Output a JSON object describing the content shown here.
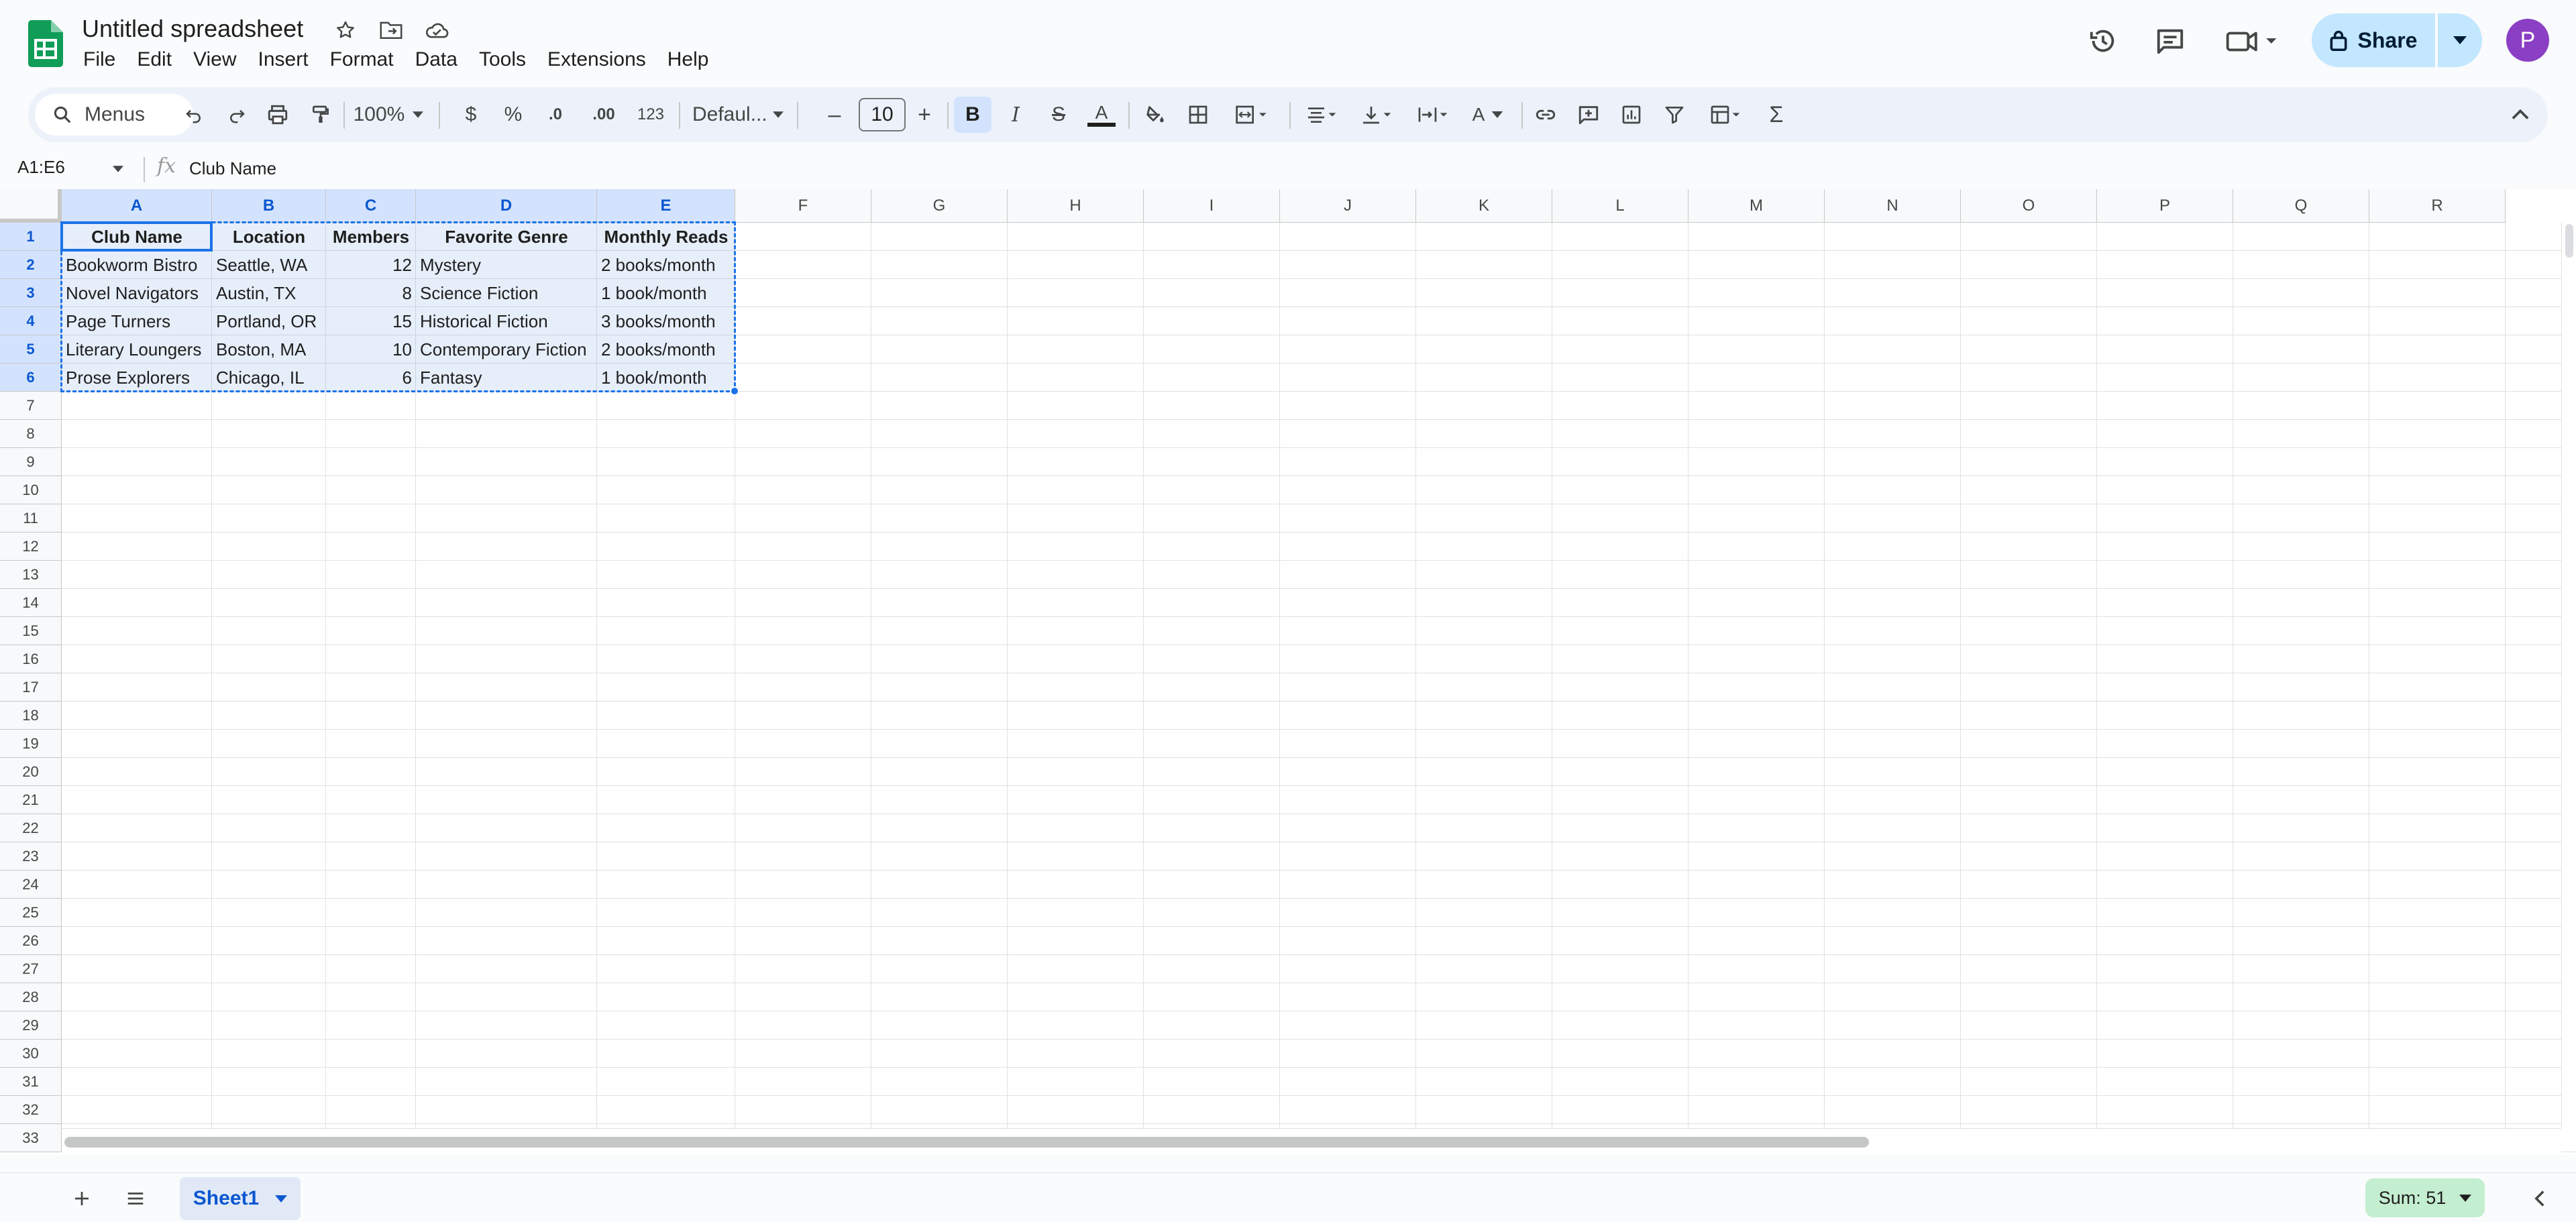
{
  "document": {
    "title": "Untitled spreadsheet",
    "menus": [
      "File",
      "Edit",
      "View",
      "Insert",
      "Format",
      "Data",
      "Tools",
      "Extensions",
      "Help"
    ]
  },
  "header_actions": {
    "share_label": "Share",
    "avatar_initial": "P"
  },
  "toolbar": {
    "search_label": "Menus",
    "zoom": "100%",
    "currency": "$",
    "percent": "%",
    "decrease_decimal": ".0",
    "increase_decimal": ".00",
    "number_format": "123",
    "font": "Defaul...",
    "font_size": "10",
    "minus": "–",
    "plus": "+",
    "bold": "B",
    "italic": "I",
    "strikethrough": "S",
    "text_color": "A",
    "text_rotation": "A",
    "functions": "Σ",
    "colors": {
      "text_color_bar": "#1f1f1f"
    }
  },
  "formula_bar": {
    "name_box": "A1:E6",
    "fx": "fx",
    "content": "Club Name"
  },
  "sheet": {
    "columns": [
      "A",
      "B",
      "C",
      "D",
      "E",
      "F",
      "G",
      "H",
      "I",
      "J",
      "K",
      "L",
      "M",
      "N",
      "O",
      "P",
      "Q",
      "R"
    ],
    "rows": [
      "1",
      "2",
      "3",
      "4",
      "5",
      "6",
      "7",
      "8",
      "9",
      "10",
      "11",
      "12",
      "13",
      "14",
      "15",
      "16",
      "17",
      "18",
      "19",
      "20",
      "21",
      "22",
      "23",
      "24",
      "25",
      "26",
      "27",
      "28",
      "29",
      "30",
      "31",
      "32",
      "33"
    ],
    "data": [
      [
        "Club Name",
        "Location",
        "Members",
        "Favorite Genre",
        "Monthly Reads"
      ],
      [
        "Bookworm Bistro",
        "Seattle, WA",
        "12",
        "Mystery",
        "2 books/month"
      ],
      [
        "Novel Navigators",
        "Austin, TX",
        "8",
        "Science Fiction",
        "1 book/month"
      ],
      [
        "Page Turners",
        "Portland, OR",
        "15",
        "Historical Fiction",
        "3 books/month"
      ],
      [
        "Literary Loungers",
        "Boston, MA",
        "10",
        "Contemporary Fiction",
        "2 books/month"
      ],
      [
        "Prose Explorers",
        "Chicago, IL",
        "6",
        "Fantasy",
        "1 book/month"
      ]
    ],
    "selection": "A1:E6",
    "accent": "#1a73e8"
  },
  "footer": {
    "sheet_tab": "Sheet1",
    "sum": "Sum: 51"
  }
}
